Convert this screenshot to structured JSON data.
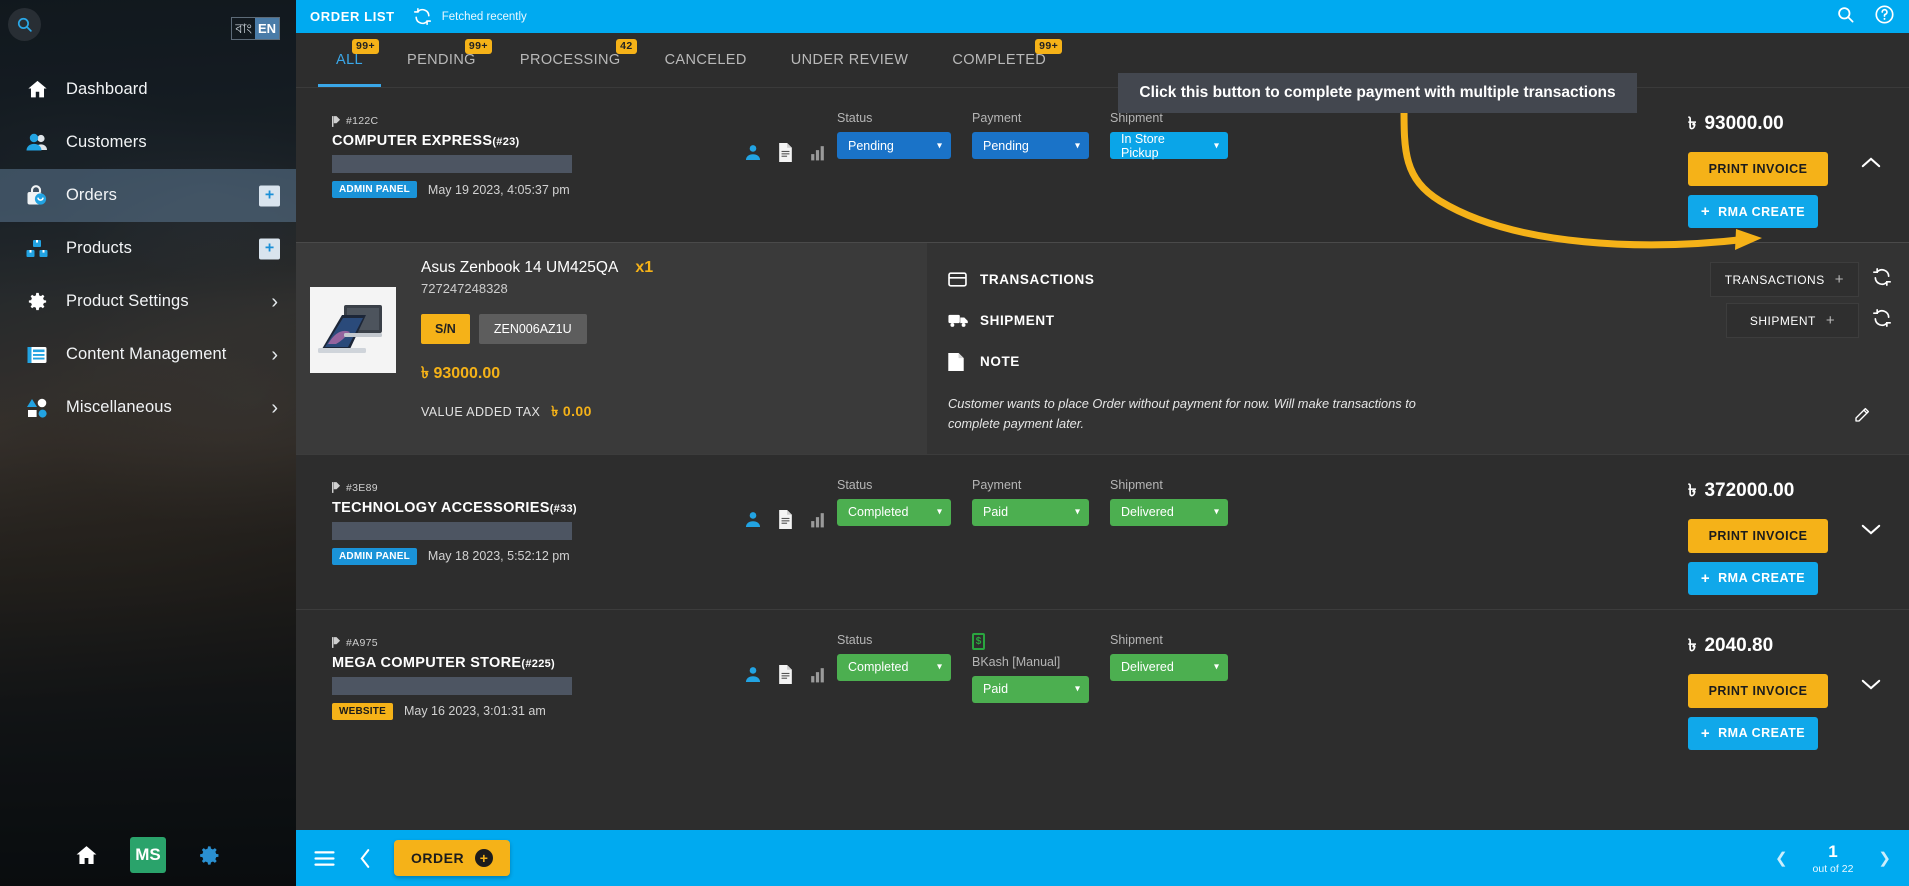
{
  "sidebar": {
    "search_icon": "search-icon",
    "lang": {
      "bn": "বাং",
      "en": "EN"
    },
    "items": [
      {
        "label": "Dashboard",
        "icon": "home-icon",
        "active": false,
        "accessory": "none"
      },
      {
        "label": "Customers",
        "icon": "people-icon",
        "active": false,
        "accessory": "none"
      },
      {
        "label": "Orders",
        "icon": "bag-icon",
        "active": true,
        "accessory": "plus"
      },
      {
        "label": "Products",
        "icon": "boxes-icon",
        "active": false,
        "accessory": "plus"
      },
      {
        "label": "Product Settings",
        "icon": "gear-icon",
        "active": false,
        "accessory": "chevron"
      },
      {
        "label": "Content Management",
        "icon": "article-icon",
        "active": false,
        "accessory": "chevron"
      },
      {
        "label": "Miscellaneous",
        "icon": "shapes-icon",
        "active": false,
        "accessory": "chevron"
      }
    ],
    "footer": {
      "home_icon": "home-icon",
      "brand": "MS",
      "settings_icon": "settings-gear-icon"
    }
  },
  "topbar": {
    "title": "ORDER LIST",
    "sync_icon": "sync-icon",
    "fetched": "Fetched recently",
    "search_icon": "search-icon",
    "help_icon": "help-circle-icon"
  },
  "tabs": [
    {
      "label": "ALL",
      "badge": "99+",
      "active": true
    },
    {
      "label": "PENDING",
      "badge": "99+",
      "active": false
    },
    {
      "label": "PROCESSING",
      "badge": "42",
      "active": false
    },
    {
      "label": "CANCELED",
      "badge": "",
      "active": false
    },
    {
      "label": "UNDER REVIEW",
      "badge": "",
      "active": false
    },
    {
      "label": "COMPLETED",
      "badge": "99+",
      "active": false
    }
  ],
  "callout": {
    "text": "Click this button to complete payment with multiple transactions",
    "arrow_color": "#f5b218"
  },
  "labels": {
    "status": "Status",
    "payment": "Payment",
    "shipment": "Shipment",
    "print_invoice": "PRINT INVOICE",
    "rma_create": "RMA CREATE",
    "transactions": "TRANSACTIONS",
    "shipment_section": "SHIPMENT",
    "note": "NOTE",
    "value_added_tax": "VALUE ADDED TAX",
    "sn": "S/N",
    "taka": "৳"
  },
  "orders": [
    {
      "code": "#122C",
      "name": "COMPUTER EXPRESS",
      "number": "(#23)",
      "source": "ADMIN PANEL",
      "source_type": "admin",
      "date": "May 19 2023, 4:05:37 pm",
      "status": {
        "label": "Status",
        "value": "Pending",
        "color": "blue"
      },
      "payment": {
        "label": "Payment",
        "value": "Pending",
        "color": "blue"
      },
      "shipment": {
        "label": "Shipment",
        "value": "In Store Pickup",
        "color": "cyan"
      },
      "total": "93000.00",
      "expanded": true,
      "product": {
        "title": "Asus Zenbook 14 UM425QA",
        "qty": "x1",
        "sku": "727247248328",
        "sn_label": "S/N",
        "sn_value": "ZEN006AZ1U",
        "price": "93000.00",
        "vat_label": "VALUE ADDED TAX",
        "vat_value": "0.00"
      },
      "panel": {
        "transactions_label": "TRANSACTIONS",
        "transactions_btn": "TRANSACTIONS",
        "shipment_label": "SHIPMENT",
        "shipment_btn": "SHIPMENT",
        "note_label": "NOTE",
        "note_text": "Customer wants to place Order without payment for now. Will make transactions to complete payment later."
      }
    },
    {
      "code": "#3E89",
      "name": "TECHNOLOGY ACCESSORIES",
      "number": "(#33)",
      "source": "ADMIN PANEL",
      "source_type": "admin",
      "date": "May 18 2023, 5:52:12 pm",
      "status": {
        "label": "Status",
        "value": "Completed",
        "color": "green"
      },
      "payment": {
        "label": "Payment",
        "value": "Paid",
        "color": "green"
      },
      "shipment": {
        "label": "Shipment",
        "value": "Delivered",
        "color": "green"
      },
      "total": "372000.00",
      "expanded": false
    },
    {
      "code": "#A975",
      "name": "MEGA COMPUTER STORE",
      "number": "(#225)",
      "source": "WEBSITE",
      "source_type": "website",
      "date": "May 16 2023, 3:01:31 am",
      "status": {
        "label": "Status",
        "value": "Completed",
        "color": "green"
      },
      "payment": {
        "label": "BKash [Manual]",
        "value": "Paid",
        "color": "green",
        "has_money_icon": true
      },
      "shipment": {
        "label": "Shipment",
        "value": "Delivered",
        "color": "green"
      },
      "total": "2040.80",
      "expanded": false
    }
  ],
  "footer": {
    "menu_icon": "hamburger-icon",
    "back_icon": "chevron-left-icon",
    "order_button": "ORDER",
    "page": "1",
    "out_of": "out of 22",
    "prev_icon": "chevron-left-icon",
    "next_icon": "chevron-right-icon"
  },
  "colors": {
    "accent_blue": "#00aaf0",
    "amber": "#f5b218",
    "green": "#4caf50",
    "panel": "#2d2d2d"
  }
}
